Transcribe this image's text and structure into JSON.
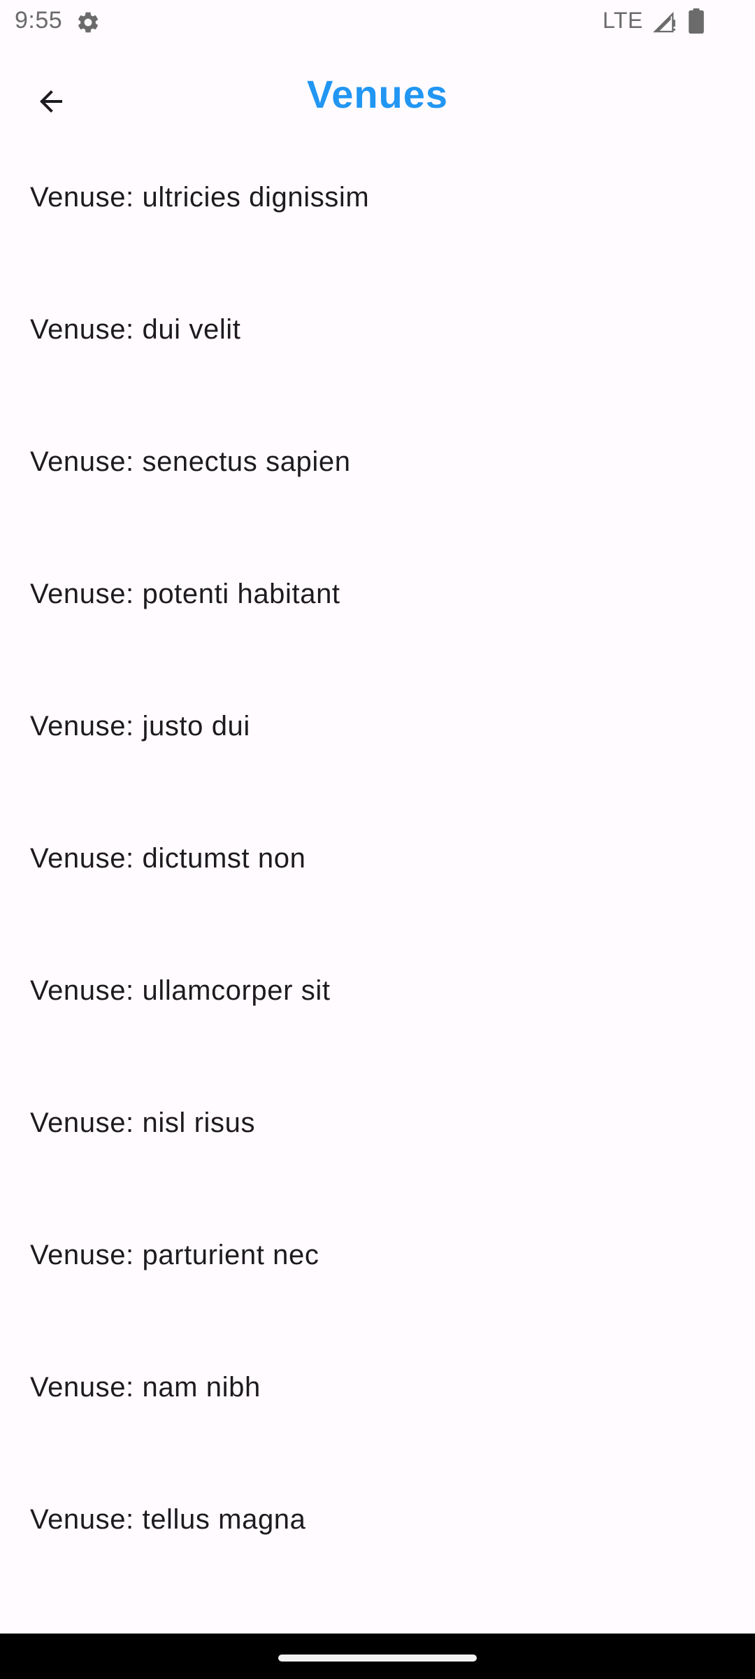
{
  "status_bar": {
    "time": "9:55",
    "network": "LTE",
    "icons": [
      "gear-icon",
      "signal-icon",
      "battery-icon"
    ]
  },
  "app_bar": {
    "title": "Venues",
    "back_icon": "arrow-back-icon",
    "title_color": "#2196f3"
  },
  "venues": [
    "Venuse: ultricies dignissim",
    "Venuse: dui velit",
    "Venuse: senectus sapien",
    "Venuse: potenti habitant",
    "Venuse: justo dui",
    "Venuse: dictumst non",
    "Venuse: ullamcorper sit",
    "Venuse: nisl risus",
    "Venuse: parturient nec",
    "Venuse: nam nibh",
    "Venuse: tellus magna"
  ],
  "colors": {
    "background": "#fffbfe",
    "text": "#1d1b20",
    "nav_bar": "#000000"
  }
}
